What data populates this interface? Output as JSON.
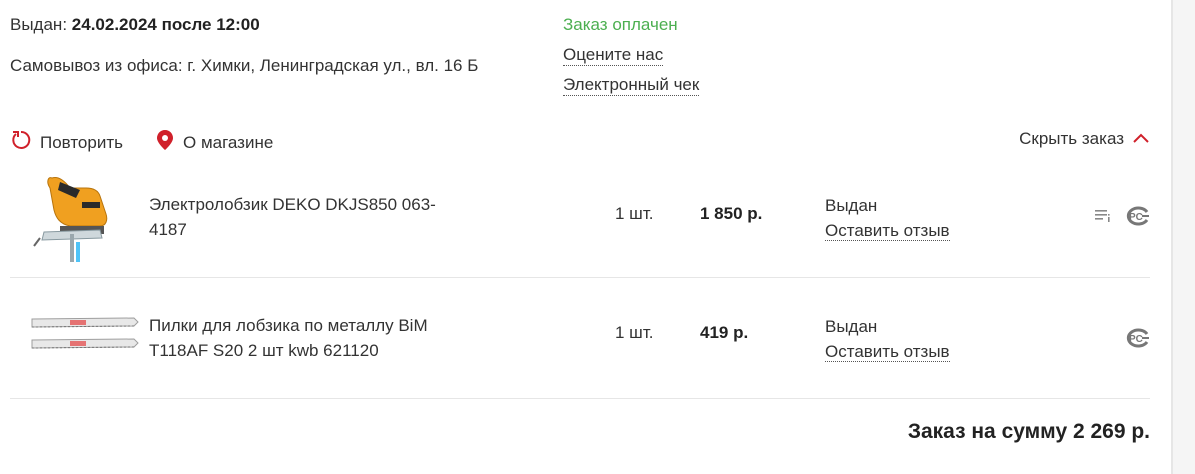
{
  "order": {
    "issued_label": "Выдан:",
    "issued_value": "24.02.2024 после 12:00",
    "pickup": "Самовывоз из офиса: г. Химки, Ленинградская ул., вл. 16 Б",
    "status": "Заказ оплачен",
    "rate_link": "Оцените нас",
    "receipt_link": "Электронный чек",
    "repeat_label": "Повторить",
    "store_label": "О магазине",
    "hide_label": "Скрыть заказ",
    "total": "Заказ на сумму 2 269 р."
  },
  "items": [
    {
      "name": "Электролобзик DEKO DKJS850 063-4187",
      "qty": "1 шт.",
      "price": "1 850 р.",
      "status": "Выдан",
      "review": "Оставить отзыв"
    },
    {
      "name": "Пилки для лобзика по металлу BiM T118AF S20 2 шт kwb 621120",
      "qty": "1 шт.",
      "price": "419 р.",
      "status": "Выдан",
      "review": "Оставить отзыв"
    }
  ],
  "colors": {
    "accent": "#d0202a",
    "paid": "#4caf50"
  }
}
